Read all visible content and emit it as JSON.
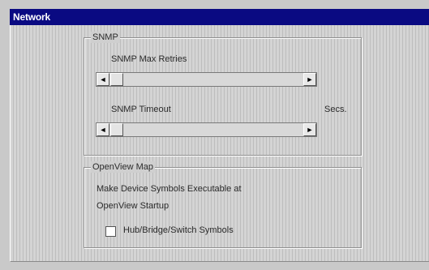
{
  "window": {
    "title": "Network"
  },
  "snmp": {
    "group_title": "SNMP",
    "max_retries_label": "SNMP Max Retries",
    "timeout_label": "SNMP Timeout",
    "timeout_unit": "Secs.",
    "left_arrow_glyph": "◄",
    "right_arrow_glyph": "►"
  },
  "openview": {
    "group_title": "OpenView Map",
    "description_line1": "Make Device Symbols Executable at",
    "description_line2": "OpenView Startup",
    "checkbox_label": "Hub/Bridge/Switch Symbols",
    "checkbox_checked": false
  },
  "colors": {
    "titlebar": "#0a0a82"
  }
}
